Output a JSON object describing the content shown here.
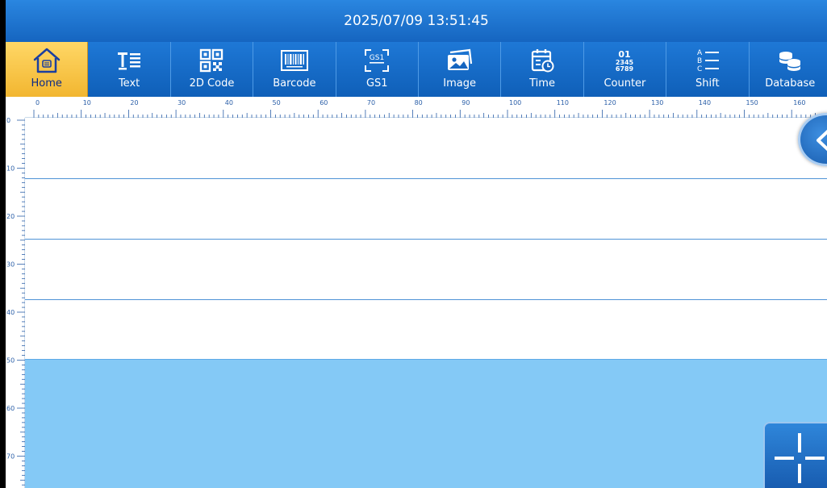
{
  "header": {
    "datetime": "2025/07/09 13:51:45"
  },
  "toolbar": {
    "items": [
      {
        "label": "Home",
        "icon": "home-icon",
        "active": true
      },
      {
        "label": "Text",
        "icon": "text-icon"
      },
      {
        "label": "2D Code",
        "icon": "qr-code-icon"
      },
      {
        "label": "Barcode",
        "icon": "barcode-icon"
      },
      {
        "label": "GS1",
        "icon": "gs1-icon"
      },
      {
        "label": "Image",
        "icon": "image-icon"
      },
      {
        "label": "Time",
        "icon": "calendar-clock-icon"
      },
      {
        "label": "Counter",
        "icon": "counter-icon"
      },
      {
        "label": "Shift",
        "icon": "shift-list-icon"
      },
      {
        "label": "Database",
        "icon": "database-icon"
      }
    ],
    "counter_icon_lines": [
      "01",
      "2345",
      "6789"
    ],
    "gs1_icon_text": "GS1",
    "shift_icon_letters": [
      "A",
      "B",
      "C"
    ],
    "next_icon": "chevron-left-icon"
  },
  "ruler": {
    "horizontal_labels": [
      "0",
      "10",
      "20",
      "30",
      "40",
      "50",
      "60",
      "70",
      "80",
      "90",
      "100",
      "110",
      "120",
      "130",
      "140",
      "150",
      "160"
    ],
    "vertical_labels": [
      "0",
      "10",
      "20",
      "30",
      "40",
      "50",
      "60",
      "70"
    ]
  },
  "floating": {
    "collapse_icon": "chevron-left-icon",
    "move_icon": "crosshair-icon"
  },
  "colors": {
    "header_blue": "#1e78d6",
    "active_tab": "#f2b630",
    "non_print_area": "#84c9f6",
    "guide_line": "#4f93d6"
  }
}
